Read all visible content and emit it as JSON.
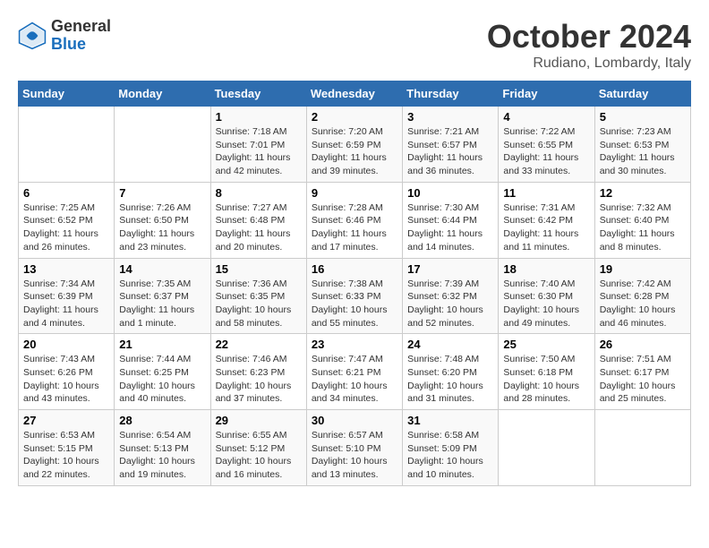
{
  "header": {
    "logo_line1": "General",
    "logo_line2": "Blue",
    "month_title": "October 2024",
    "subtitle": "Rudiano, Lombardy, Italy"
  },
  "weekdays": [
    "Sunday",
    "Monday",
    "Tuesday",
    "Wednesday",
    "Thursday",
    "Friday",
    "Saturday"
  ],
  "weeks": [
    [
      {
        "day": "",
        "sunrise": "",
        "sunset": "",
        "daylight": ""
      },
      {
        "day": "",
        "sunrise": "",
        "sunset": "",
        "daylight": ""
      },
      {
        "day": "1",
        "sunrise": "Sunrise: 7:18 AM",
        "sunset": "Sunset: 7:01 PM",
        "daylight": "Daylight: 11 hours and 42 minutes."
      },
      {
        "day": "2",
        "sunrise": "Sunrise: 7:20 AM",
        "sunset": "Sunset: 6:59 PM",
        "daylight": "Daylight: 11 hours and 39 minutes."
      },
      {
        "day": "3",
        "sunrise": "Sunrise: 7:21 AM",
        "sunset": "Sunset: 6:57 PM",
        "daylight": "Daylight: 11 hours and 36 minutes."
      },
      {
        "day": "4",
        "sunrise": "Sunrise: 7:22 AM",
        "sunset": "Sunset: 6:55 PM",
        "daylight": "Daylight: 11 hours and 33 minutes."
      },
      {
        "day": "5",
        "sunrise": "Sunrise: 7:23 AM",
        "sunset": "Sunset: 6:53 PM",
        "daylight": "Daylight: 11 hours and 30 minutes."
      }
    ],
    [
      {
        "day": "6",
        "sunrise": "Sunrise: 7:25 AM",
        "sunset": "Sunset: 6:52 PM",
        "daylight": "Daylight: 11 hours and 26 minutes."
      },
      {
        "day": "7",
        "sunrise": "Sunrise: 7:26 AM",
        "sunset": "Sunset: 6:50 PM",
        "daylight": "Daylight: 11 hours and 23 minutes."
      },
      {
        "day": "8",
        "sunrise": "Sunrise: 7:27 AM",
        "sunset": "Sunset: 6:48 PM",
        "daylight": "Daylight: 11 hours and 20 minutes."
      },
      {
        "day": "9",
        "sunrise": "Sunrise: 7:28 AM",
        "sunset": "Sunset: 6:46 PM",
        "daylight": "Daylight: 11 hours and 17 minutes."
      },
      {
        "day": "10",
        "sunrise": "Sunrise: 7:30 AM",
        "sunset": "Sunset: 6:44 PM",
        "daylight": "Daylight: 11 hours and 14 minutes."
      },
      {
        "day": "11",
        "sunrise": "Sunrise: 7:31 AM",
        "sunset": "Sunset: 6:42 PM",
        "daylight": "Daylight: 11 hours and 11 minutes."
      },
      {
        "day": "12",
        "sunrise": "Sunrise: 7:32 AM",
        "sunset": "Sunset: 6:40 PM",
        "daylight": "Daylight: 11 hours and 8 minutes."
      }
    ],
    [
      {
        "day": "13",
        "sunrise": "Sunrise: 7:34 AM",
        "sunset": "Sunset: 6:39 PM",
        "daylight": "Daylight: 11 hours and 4 minutes."
      },
      {
        "day": "14",
        "sunrise": "Sunrise: 7:35 AM",
        "sunset": "Sunset: 6:37 PM",
        "daylight": "Daylight: 11 hours and 1 minute."
      },
      {
        "day": "15",
        "sunrise": "Sunrise: 7:36 AM",
        "sunset": "Sunset: 6:35 PM",
        "daylight": "Daylight: 10 hours and 58 minutes."
      },
      {
        "day": "16",
        "sunrise": "Sunrise: 7:38 AM",
        "sunset": "Sunset: 6:33 PM",
        "daylight": "Daylight: 10 hours and 55 minutes."
      },
      {
        "day": "17",
        "sunrise": "Sunrise: 7:39 AM",
        "sunset": "Sunset: 6:32 PM",
        "daylight": "Daylight: 10 hours and 52 minutes."
      },
      {
        "day": "18",
        "sunrise": "Sunrise: 7:40 AM",
        "sunset": "Sunset: 6:30 PM",
        "daylight": "Daylight: 10 hours and 49 minutes."
      },
      {
        "day": "19",
        "sunrise": "Sunrise: 7:42 AM",
        "sunset": "Sunset: 6:28 PM",
        "daylight": "Daylight: 10 hours and 46 minutes."
      }
    ],
    [
      {
        "day": "20",
        "sunrise": "Sunrise: 7:43 AM",
        "sunset": "Sunset: 6:26 PM",
        "daylight": "Daylight: 10 hours and 43 minutes."
      },
      {
        "day": "21",
        "sunrise": "Sunrise: 7:44 AM",
        "sunset": "Sunset: 6:25 PM",
        "daylight": "Daylight: 10 hours and 40 minutes."
      },
      {
        "day": "22",
        "sunrise": "Sunrise: 7:46 AM",
        "sunset": "Sunset: 6:23 PM",
        "daylight": "Daylight: 10 hours and 37 minutes."
      },
      {
        "day": "23",
        "sunrise": "Sunrise: 7:47 AM",
        "sunset": "Sunset: 6:21 PM",
        "daylight": "Daylight: 10 hours and 34 minutes."
      },
      {
        "day": "24",
        "sunrise": "Sunrise: 7:48 AM",
        "sunset": "Sunset: 6:20 PM",
        "daylight": "Daylight: 10 hours and 31 minutes."
      },
      {
        "day": "25",
        "sunrise": "Sunrise: 7:50 AM",
        "sunset": "Sunset: 6:18 PM",
        "daylight": "Daylight: 10 hours and 28 minutes."
      },
      {
        "day": "26",
        "sunrise": "Sunrise: 7:51 AM",
        "sunset": "Sunset: 6:17 PM",
        "daylight": "Daylight: 10 hours and 25 minutes."
      }
    ],
    [
      {
        "day": "27",
        "sunrise": "Sunrise: 6:53 AM",
        "sunset": "Sunset: 5:15 PM",
        "daylight": "Daylight: 10 hours and 22 minutes."
      },
      {
        "day": "28",
        "sunrise": "Sunrise: 6:54 AM",
        "sunset": "Sunset: 5:13 PM",
        "daylight": "Daylight: 10 hours and 19 minutes."
      },
      {
        "day": "29",
        "sunrise": "Sunrise: 6:55 AM",
        "sunset": "Sunset: 5:12 PM",
        "daylight": "Daylight: 10 hours and 16 minutes."
      },
      {
        "day": "30",
        "sunrise": "Sunrise: 6:57 AM",
        "sunset": "Sunset: 5:10 PM",
        "daylight": "Daylight: 10 hours and 13 minutes."
      },
      {
        "day": "31",
        "sunrise": "Sunrise: 6:58 AM",
        "sunset": "Sunset: 5:09 PM",
        "daylight": "Daylight: 10 hours and 10 minutes."
      },
      {
        "day": "",
        "sunrise": "",
        "sunset": "",
        "daylight": ""
      },
      {
        "day": "",
        "sunrise": "",
        "sunset": "",
        "daylight": ""
      }
    ]
  ]
}
